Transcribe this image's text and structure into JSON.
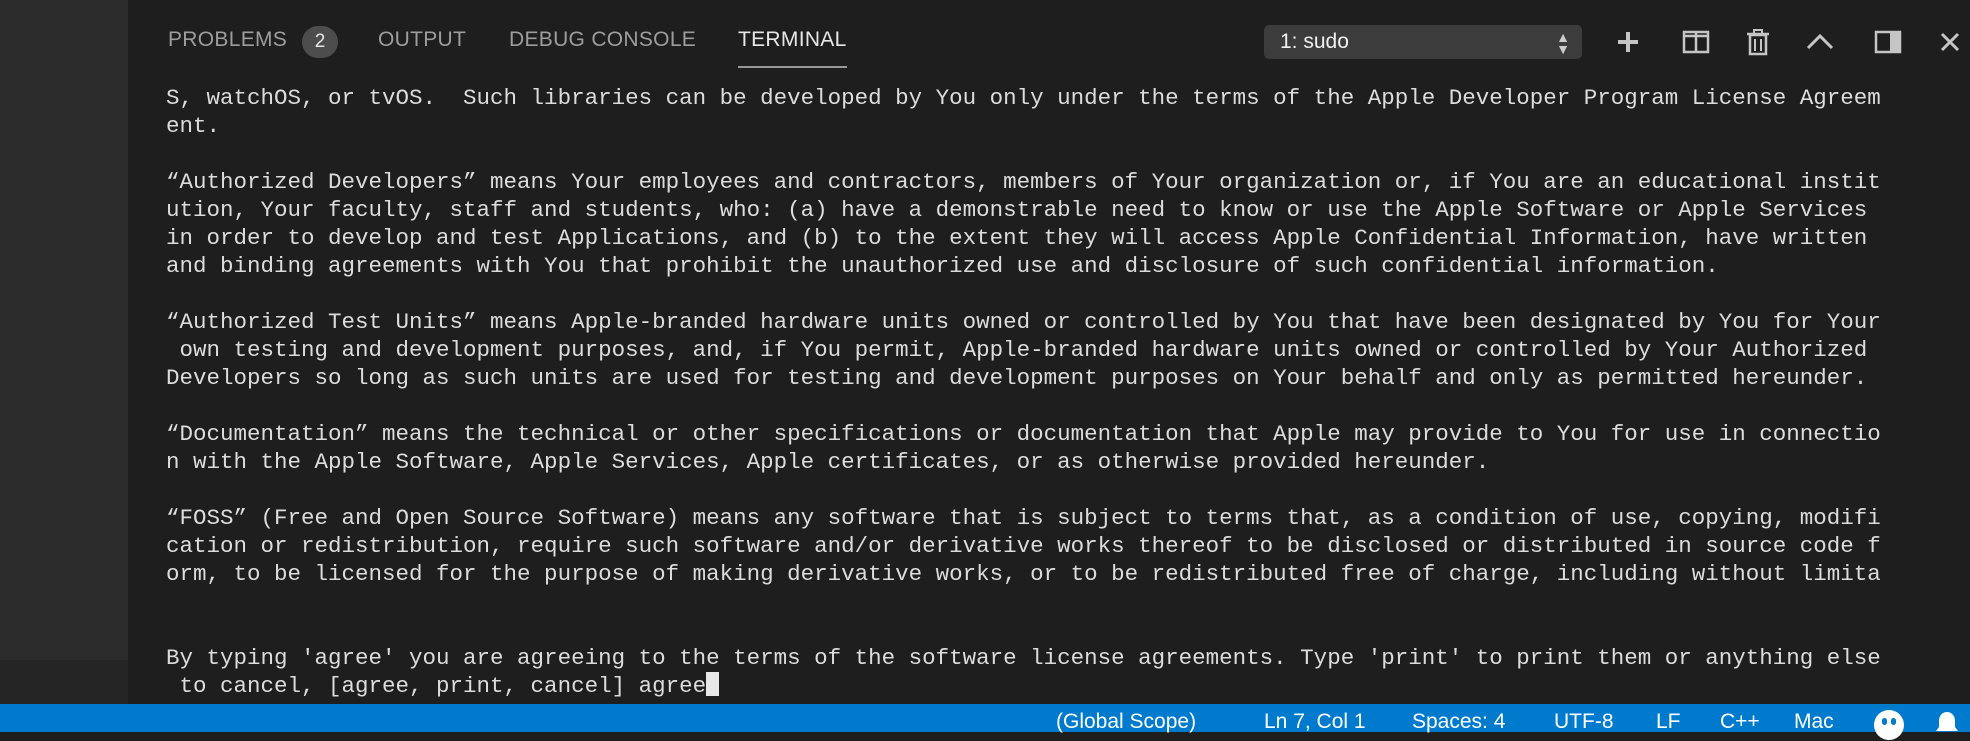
{
  "panel": {
    "tabs": [
      {
        "label": "PROBLEMS",
        "badge": "2"
      },
      {
        "label": "OUTPUT"
      },
      {
        "label": "DEBUG CONSOLE"
      },
      {
        "label": "TERMINAL",
        "active": true
      }
    ],
    "terminal_select": "1: sudo",
    "toolbar_icons": [
      "plus-icon",
      "split-terminal-icon",
      "trash-icon",
      "chevron-up-icon",
      "toggle-panel-icon",
      "close-icon"
    ]
  },
  "terminal": {
    "lines": [
      "S, watchOS, or tvOS.  Such libraries can be developed by You only under the terms of the Apple Developer Program License Agreem",
      "ent.",
      "",
      "“Authorized Developers” means Your employees and contractors, members of Your organization or, if You are an educational instit",
      "ution, Your faculty, staff and students, who: (a) have a demonstrable need to know or use the Apple Software or Apple Services",
      "in order to develop and test Applications, and (b) to the extent they will access Apple Confidential Information, have written",
      "and binding agreements with You that prohibit the unauthorized use and disclosure of such confidential information.",
      "",
      "“Authorized Test Units” means Apple-branded hardware units owned or controlled by You that have been designated by You for Your",
      " own testing and development purposes, and, if You permit, Apple-branded hardware units owned or controlled by Your Authorized",
      "Developers so long as such units are used for testing and development purposes on Your behalf and only as permitted hereunder.",
      "",
      "“Documentation” means the technical or other specifications or documentation that Apple may provide to You for use in connectio",
      "n with the Apple Software, Apple Services, Apple certificates, or as otherwise provided hereunder.",
      "",
      "“FOSS” (Free and Open Source Software) means any software that is subject to terms that, as a condition of use, copying, modifi",
      "cation or redistribution, require such software and/or derivative works thereof to be disclosed or distributed in source code f",
      "orm, to be licensed for the purpose of making derivative works, or to be redistributed free of charge, including without limita",
      "",
      "",
      "By typing 'agree' you are agreeing to the terms of the software license agreements. Type 'print' to print them or anything else",
      " to cancel, [agree, print, cancel] agree"
    ]
  },
  "statusbar": {
    "scope": "(Global Scope)",
    "position": "Ln 7, Col 1",
    "spaces": "Spaces: 4",
    "encoding": "UTF-8",
    "eol": "LF",
    "language": "C++",
    "platform": "Mac",
    "icons": [
      "smiley-icon",
      "bell-icon"
    ],
    "background_color": "#007acc"
  }
}
